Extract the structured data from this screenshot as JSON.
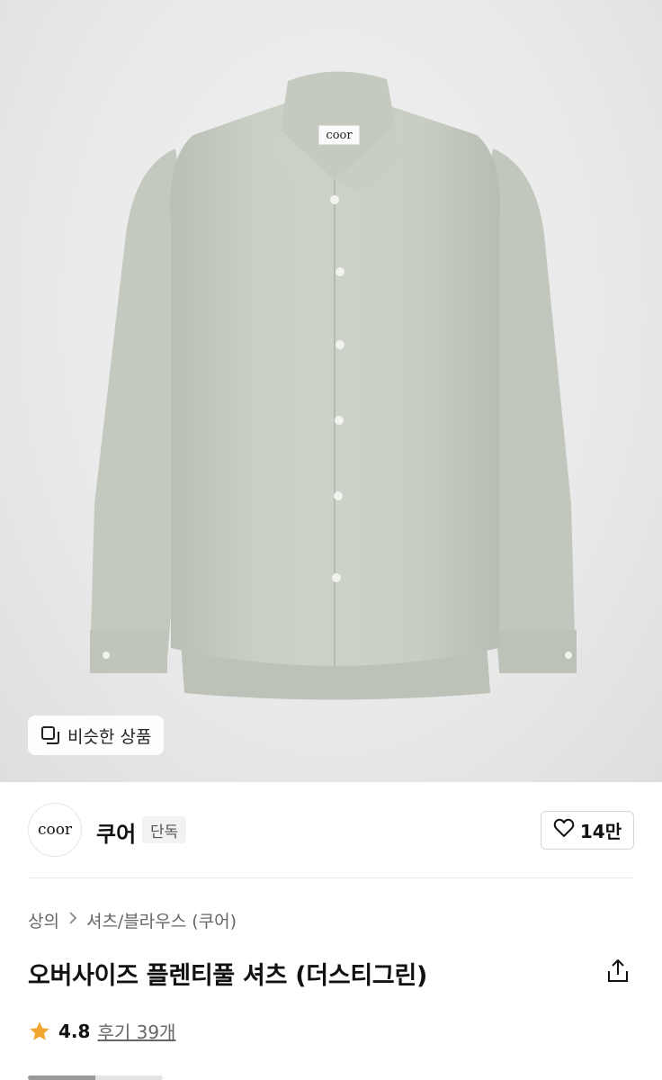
{
  "product_image": {
    "label_text": "coor",
    "similar_button_label": "비슷한 상품"
  },
  "brand": {
    "logo_text": "coor",
    "name": "쿠어",
    "tag": "단독",
    "likes": "14만"
  },
  "breadcrumb": {
    "items": [
      "상의",
      "셔츠/블라우스 (쿠어)"
    ]
  },
  "product": {
    "title": "오버사이즈 플렌티풀 셔츠 (더스티그린)"
  },
  "rating": {
    "score": "4.8",
    "reviews": "후기 39개"
  },
  "image_indicator": {
    "progress": 0.5
  },
  "colors": {
    "shirt": "#c7cdc2",
    "star": "#f2a530",
    "accent_text": "#111111"
  },
  "icons": [
    "similar-items-icon",
    "heart-icon",
    "chevron-right-icon",
    "share-icon",
    "star-icon"
  ]
}
